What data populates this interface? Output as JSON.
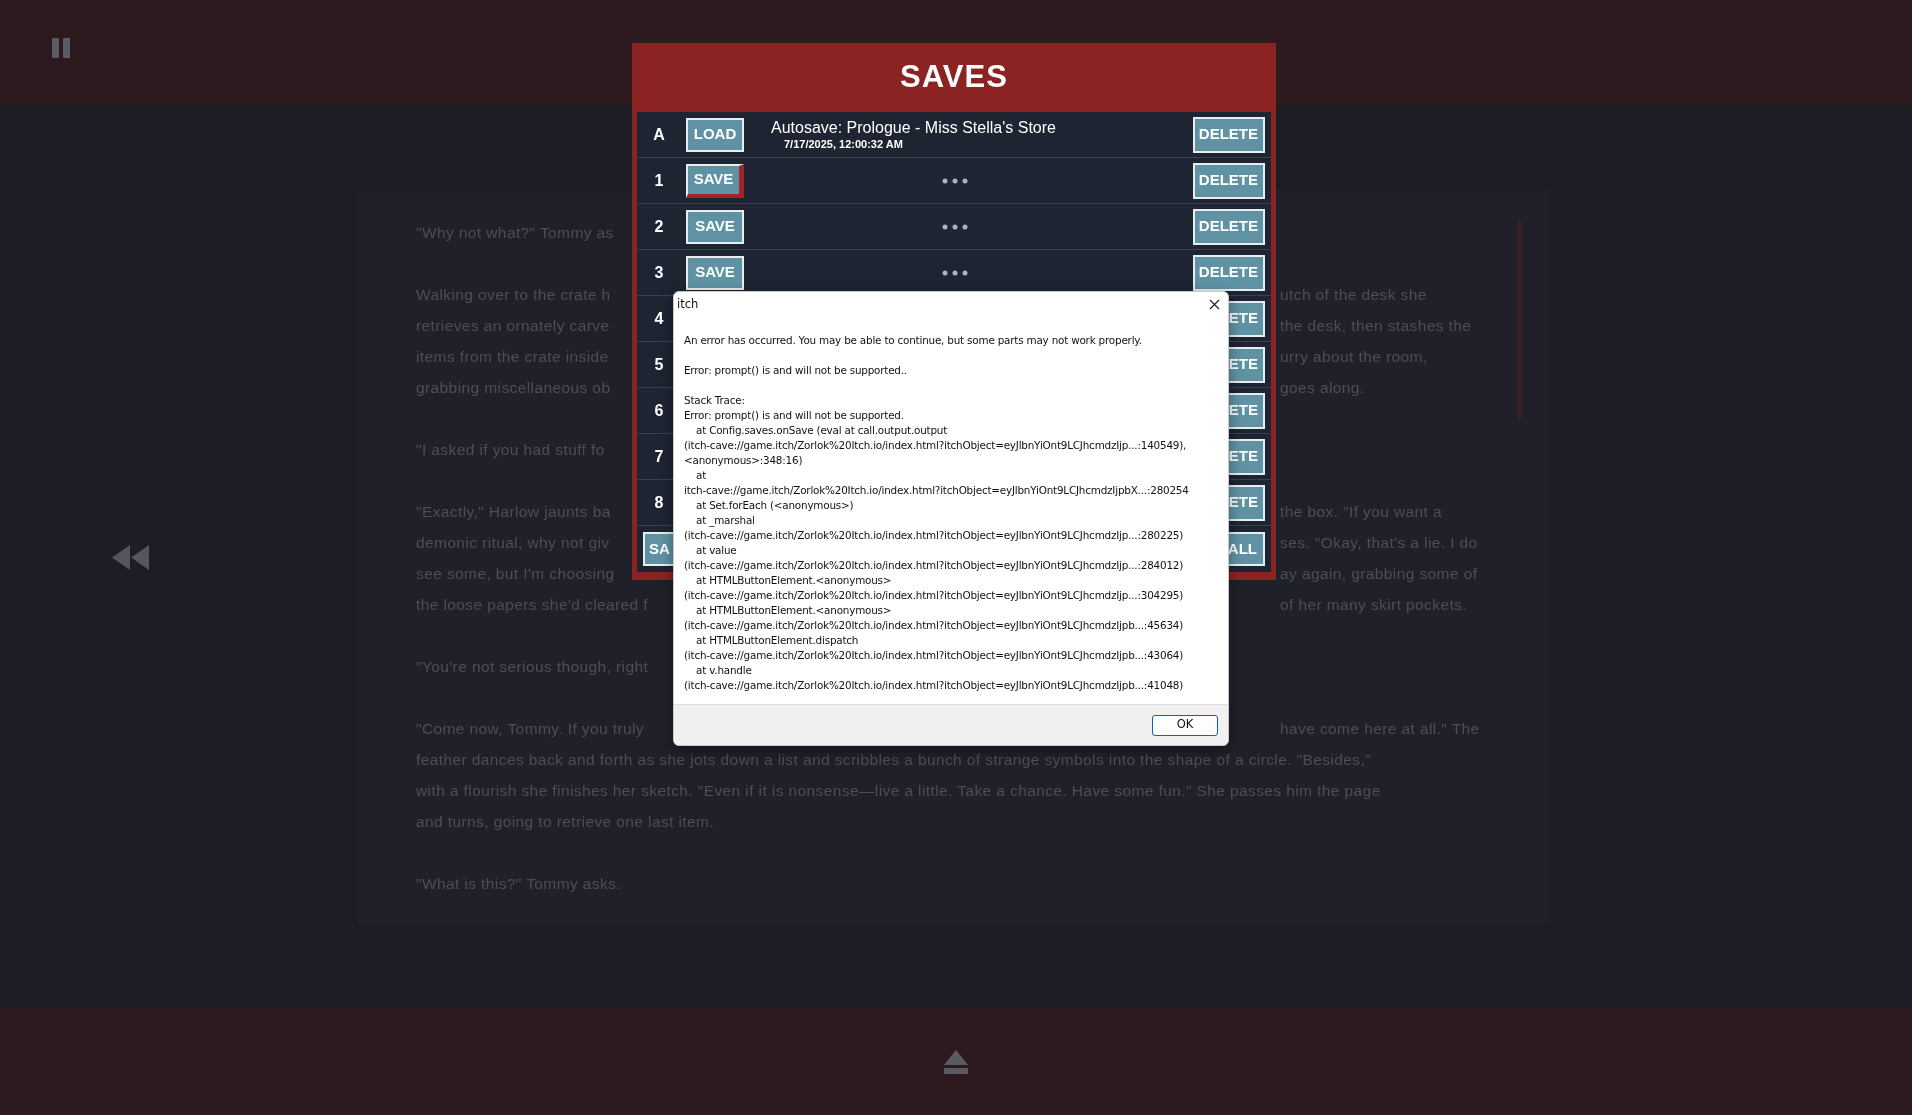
{
  "story": {
    "paragraphs": [
      {
        "lines": [
          {
            "left": "\"Why not what?\" Tommy as"
          }
        ]
      },
      {
        "lines": [
          {
            "left": "Walking over to the crate h",
            "right": "utch of the desk she"
          },
          {
            "left": "retrieves an ornately carve",
            "right": "the desk, then stashes the"
          },
          {
            "left": "items from the crate inside",
            "right": "urry about the room,"
          },
          {
            "left": "grabbing miscellaneous ob",
            "right": "goes along."
          }
        ]
      },
      {
        "lines": [
          {
            "left": "\"I asked if you had stuff fo"
          }
        ]
      },
      {
        "lines": [
          {
            "left": "\"Exactly,\" Harlow jaunts ba",
            "right": "the box. \"If you want a"
          },
          {
            "left": "demonic ritual, why not giv",
            "right": "ses. \"Okay, that's a lie. I do"
          },
          {
            "left": "see some, but I'm choosing",
            "right": "ay again, grabbing some of"
          },
          {
            "left": "the loose papers she'd cleared f",
            "right": "of her many skirt pockets."
          }
        ]
      },
      {
        "lines": [
          {
            "left": "\"You're not serious though, right"
          }
        ]
      },
      {
        "lines": [
          {
            "left": "\"Come now, Tommy. If you truly",
            "right": "have come here at all.\" The"
          },
          {
            "left": "feather dances back and forth as she jots down a list and scribbles a bunch of strange symbols into the shape of a circle. \"Besides,\""
          },
          {
            "left": "with a flourish she finishes her sketch. \"Even if it is nonsense—live a little. Take a chance. Have some fun.\" She passes him the page"
          },
          {
            "left": "and turns, going to retrieve one last item."
          }
        ]
      },
      {
        "lines": [
          {
            "left": "\"What is this?\" Tommy asks."
          }
        ]
      }
    ]
  },
  "saves_dialog": {
    "title": "SAVES",
    "rows": [
      {
        "label": "A",
        "kind": "autosave",
        "button": {
          "label": "LOAD",
          "focused": false
        },
        "title": "Autosave: Prologue - Miss Stella's Store",
        "date": "7/17/2025, 12:00:32 AM",
        "delete": "DELETE"
      },
      {
        "label": "1",
        "kind": "empty",
        "button": {
          "label": "SAVE",
          "focused": true
        },
        "delete": "DELETE"
      },
      {
        "label": "2",
        "kind": "empty",
        "button": {
          "label": "SAVE",
          "focused": false
        },
        "delete": "DELETE"
      },
      {
        "label": "3",
        "kind": "empty",
        "button": {
          "label": "SAVE",
          "focused": false
        },
        "delete": "DELETE"
      },
      {
        "label": "4",
        "kind": "covered",
        "delete": "ETE"
      },
      {
        "label": "5",
        "kind": "covered",
        "delete": "ETE"
      },
      {
        "label": "6",
        "kind": "covered",
        "delete": "ETE"
      },
      {
        "label": "7",
        "kind": "covered",
        "delete": "ETE"
      },
      {
        "label": "8",
        "kind": "covered",
        "delete": "ETE"
      }
    ],
    "footer": {
      "left_button": "SA",
      "right_button": "ALL"
    }
  },
  "error_dialog": {
    "title": "itch",
    "message": "An error has occurred. You may be able to continue, but some parts may not work properly.",
    "error": "Error: prompt() is and will not be supported..",
    "trace_heading": "Stack Trace:",
    "trace": [
      {
        "kind": "message",
        "text": "Error: prompt() is and will not be supported."
      },
      {
        "kind": "frame",
        "text": "at Config.saves.onSave (eval at call.output.output"
      },
      {
        "kind": "location",
        "text": "(itch-cave://game.itch/Zorlok%20Itch.io/index.html?itchObject=eyJlbnYiOnt9LCJhcmdzIjp...:140549),"
      },
      {
        "kind": "location",
        "text": "<anonymous>:348:16)"
      },
      {
        "kind": "frame",
        "text": "at"
      },
      {
        "kind": "location",
        "text": "itch-cave://game.itch/Zorlok%20Itch.io/index.html?itchObject=eyJlbnYiOnt9LCJhcmdzIjpbX...:280254"
      },
      {
        "kind": "frame",
        "text": "at Set.forEach (<anonymous>)"
      },
      {
        "kind": "frame",
        "text": "at _marshal"
      },
      {
        "kind": "location",
        "text": "(itch-cave://game.itch/Zorlok%20Itch.io/index.html?itchObject=eyJlbnYiOnt9LCJhcmdzIjp...:280225)"
      },
      {
        "kind": "frame",
        "text": "at value"
      },
      {
        "kind": "location",
        "text": "(itch-cave://game.itch/Zorlok%20Itch.io/index.html?itchObject=eyJlbnYiOnt9LCJhcmdzIjp...:284012)"
      },
      {
        "kind": "frame",
        "text": "at HTMLButtonElement.<anonymous>"
      },
      {
        "kind": "location",
        "text": "(itch-cave://game.itch/Zorlok%20Itch.io/index.html?itchObject=eyJlbnYiOnt9LCJhcmdzIjp...:304295)"
      },
      {
        "kind": "frame",
        "text": "at HTMLButtonElement.<anonymous>"
      },
      {
        "kind": "location",
        "text": "(itch-cave://game.itch/Zorlok%20Itch.io/index.html?itchObject=eyJlbnYiOnt9LCJhcmdzIjpb...:45634)"
      },
      {
        "kind": "frame",
        "text": "at HTMLButtonElement.dispatch"
      },
      {
        "kind": "location",
        "text": "(itch-cave://game.itch/Zorlok%20Itch.io/index.html?itchObject=eyJlbnYiOnt9LCJhcmdzIjpb...:43064)"
      },
      {
        "kind": "frame",
        "text": "at v.handle"
      },
      {
        "kind": "location",
        "text": "(itch-cave://game.itch/Zorlok%20Itch.io/index.html?itchObject=eyJlbnYiOnt9LCJhcmdzIjpb...:41048)"
      }
    ],
    "ok_button": "OK"
  }
}
